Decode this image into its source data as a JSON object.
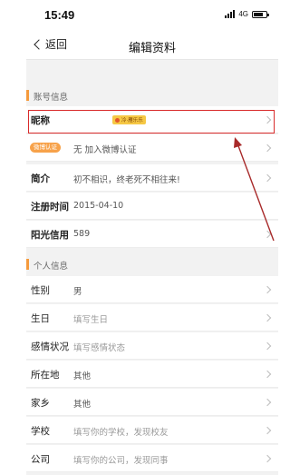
{
  "status": {
    "time": "15:49",
    "network": "4G",
    "battery_level": 0.8
  },
  "nav": {
    "back_label": "返回",
    "title": "编辑资料"
  },
  "account_section": {
    "title": "账号信息",
    "rows": [
      {
        "label": "昵称",
        "value": "",
        "tag": "冷·雁乐乐"
      },
      {
        "badge": "微博认证",
        "value": "无 加入微博认证"
      },
      {
        "label": "简介",
        "value": "初不相识，终老死不相往来!"
      },
      {
        "label": "注册时间",
        "value": "2015-04-10"
      },
      {
        "label": "阳光信用",
        "value": "589"
      }
    ]
  },
  "personal_section": {
    "title": "个人信息",
    "rows": [
      {
        "label": "性别",
        "value": "男"
      },
      {
        "label": "生日",
        "value": "填写生日"
      },
      {
        "label": "感情状况",
        "value": "填写感情状态"
      },
      {
        "label": "所在地",
        "value": "其他"
      },
      {
        "label": "家乡",
        "value": "其他"
      },
      {
        "label": "学校",
        "value": "填写你的学校，发现校友"
      },
      {
        "label": "公司",
        "value": "填写你的公司，发现同事"
      }
    ]
  },
  "colors": {
    "accent": "#f59a3c",
    "highlight": "#d92b2b",
    "arrow": "#a82a2a"
  }
}
